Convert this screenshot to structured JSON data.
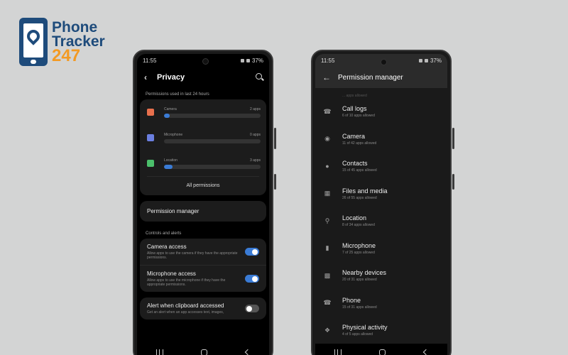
{
  "logo": {
    "line1": "Phone",
    "line2": "Tracker",
    "line3": "247"
  },
  "left_phone": {
    "status": {
      "time": "11:55",
      "battery": "37%"
    },
    "title": "Privacy",
    "section_usage": "Permissions used in last 24 hours",
    "usage": [
      {
        "label": "Camera",
        "count": "2 apps",
        "fraction": 0.06,
        "icon": "camera-icon",
        "color": "#e8704d"
      },
      {
        "label": "Microphone",
        "count": "0 apps",
        "fraction": 0.0,
        "icon": "microphone-icon",
        "color": "#6b7fe0"
      },
      {
        "label": "Location",
        "count": "3 apps",
        "fraction": 0.09,
        "icon": "location-icon",
        "color": "#4bbf6b"
      }
    ],
    "all_permissions": "All permissions",
    "permission_manager": "Permission manager",
    "section_controls": "Controls and alerts",
    "toggles": [
      {
        "title": "Camera access",
        "desc": "Allow apps to use the camera if they have the appropriate permissions.",
        "state": "on"
      },
      {
        "title": "Microphone access",
        "desc": "Allow apps to use the microphone if they have the appropriate permissions.",
        "state": "on"
      }
    ],
    "clipboard": {
      "title": "Alert when clipboard accessed",
      "desc": "Get an alert when an app accesses text, images,",
      "state": "off"
    }
  },
  "right_phone": {
    "status": {
      "time": "11:55",
      "battery": "37%"
    },
    "title": "Permission manager",
    "cut_text": "... apps allowed",
    "items": [
      {
        "title": "Call logs",
        "sub": "6 of 10 apps allowed",
        "icon": "call-log-icon"
      },
      {
        "title": "Camera",
        "sub": "11 of 42 apps allowed",
        "icon": "camera-icon"
      },
      {
        "title": "Contacts",
        "sub": "15 of 45 apps allowed",
        "icon": "contacts-icon"
      },
      {
        "title": "Files and media",
        "sub": "26 of 55 apps allowed",
        "icon": "folder-icon"
      },
      {
        "title": "Location",
        "sub": "8 of 34 apps allowed",
        "icon": "location-icon"
      },
      {
        "title": "Microphone",
        "sub": "7 of 25 apps allowed",
        "icon": "microphone-icon"
      },
      {
        "title": "Nearby devices",
        "sub": "20 of 31 apps allowed",
        "icon": "nearby-devices-icon"
      },
      {
        "title": "Phone",
        "sub": "15 of 31 apps allowed",
        "icon": "phone-icon"
      },
      {
        "title": "Physical activity",
        "sub": "4 of 5 apps allowed",
        "icon": "activity-icon"
      }
    ]
  }
}
